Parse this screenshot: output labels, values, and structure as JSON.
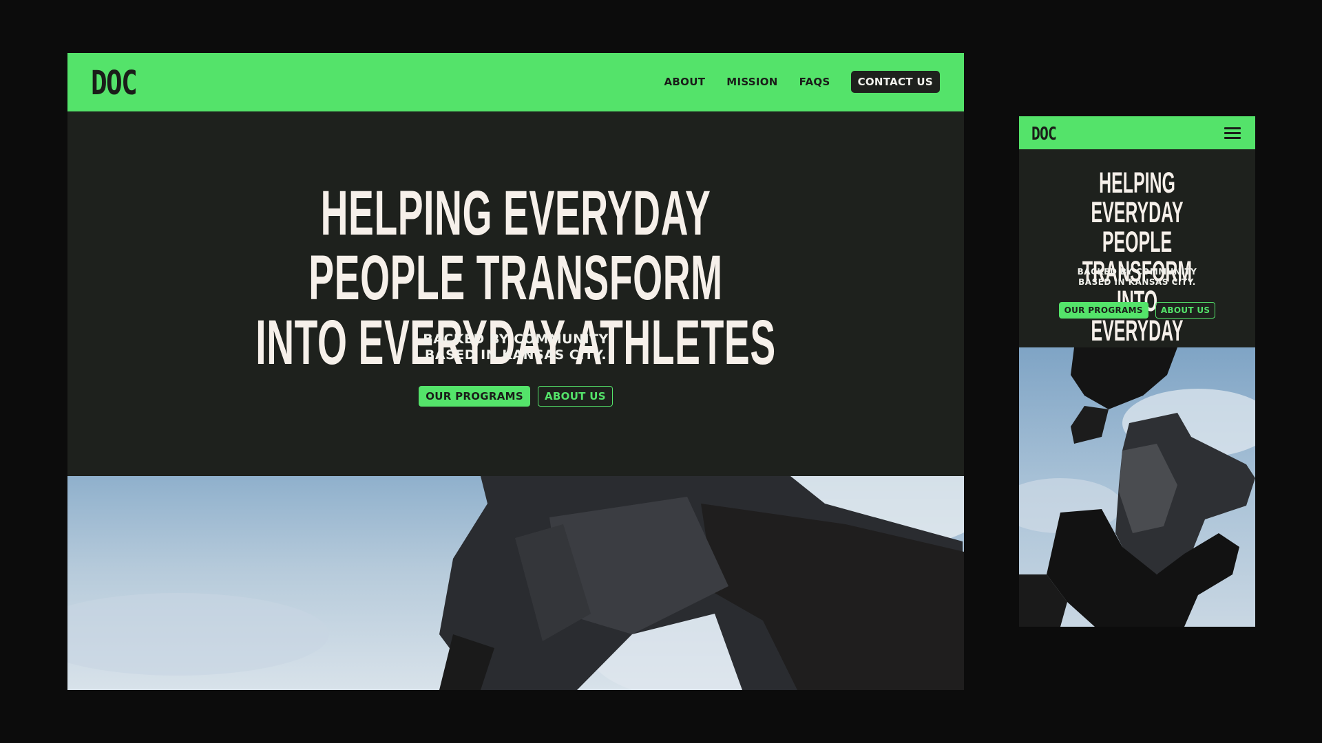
{
  "desktop": {
    "logo": "DOC",
    "nav": {
      "about": "ABOUT",
      "mission": "MISSION",
      "faqs": "FAQS",
      "contact": "CONTACT US"
    },
    "hero": {
      "title_line1": "HELPING EVERYDAY PEOPLE TRANSFORM",
      "title_line2": "INTO EVERYDAY ATHLETES",
      "subtitle_line1": "BACKED BY COMMUNITY",
      "subtitle_line2": "BASED IN KANSAS CITY.",
      "primary_button": "OUR PROGRAMS",
      "secondary_button": "ABOUT US"
    }
  },
  "mobile": {
    "logo": "DOC",
    "menu_icon": "hamburger-icon",
    "hero": {
      "title_line1": "HELPING EVERYDAY",
      "title_line2": "PEOPLE TRANSFORM INTO",
      "title_line3": "EVERYDAY ATHLETES",
      "subtitle_line1": "BACKED BY COMMUNITY",
      "subtitle_line2": "BASED IN KANSAS CITY.",
      "primary_button": "OUR PROGRAMS",
      "secondary_button": "ABOUT US"
    }
  },
  "colors": {
    "page_background": "#0c0c0c",
    "accent_green": "#54e36a",
    "hero_background": "#1e211d",
    "hero_text": "#f6f0ea"
  }
}
